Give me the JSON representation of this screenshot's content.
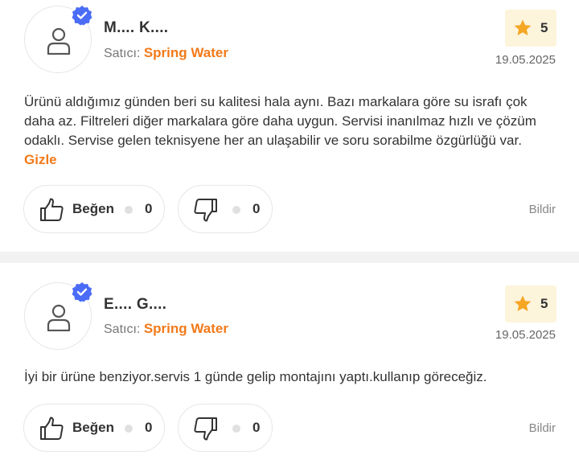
{
  "reviews": [
    {
      "reviewer": "M.... K....",
      "seller_label": "Satıcı:",
      "seller_name": "Spring Water",
      "rating": "5",
      "date": "19.05.2025",
      "text": "Ürünü aldığımız günden beri su kalitesi hala aynı. Bazı markalara göre su israfı çok daha az. Filtreleri diğer markalara göre daha uygun. Servisi inanılmaz hızlı ve çözüm odaklı. Servise gelen teknisyene her an ulaşabilir ve soru sorabilme özgürlüğü var.",
      "hide_label": "Gizle",
      "like_label": "Beğen",
      "like_count": "0",
      "dislike_count": "0",
      "report_label": "Bildir"
    },
    {
      "reviewer": "E.... G....",
      "seller_label": "Satıcı:",
      "seller_name": "Spring Water",
      "rating": "5",
      "date": "19.05.2025",
      "text": "İyi bir ürüne benziyor.servis 1 günde gelip montajını yaptı.kullanıp göreceğiz.",
      "like_label": "Beğen",
      "like_count": "0",
      "dislike_count": "0",
      "report_label": "Bildir"
    }
  ],
  "colors": {
    "accent": "#f27a1a",
    "verified": "#4a6cf7",
    "star": "#f5a623",
    "rating_bg": "#fdf4dc"
  },
  "icons": {
    "avatar": "user-icon",
    "verified": "verified-badge-icon",
    "star": "star-icon",
    "like": "thumbs-up-icon",
    "dislike": "thumbs-down-icon"
  }
}
